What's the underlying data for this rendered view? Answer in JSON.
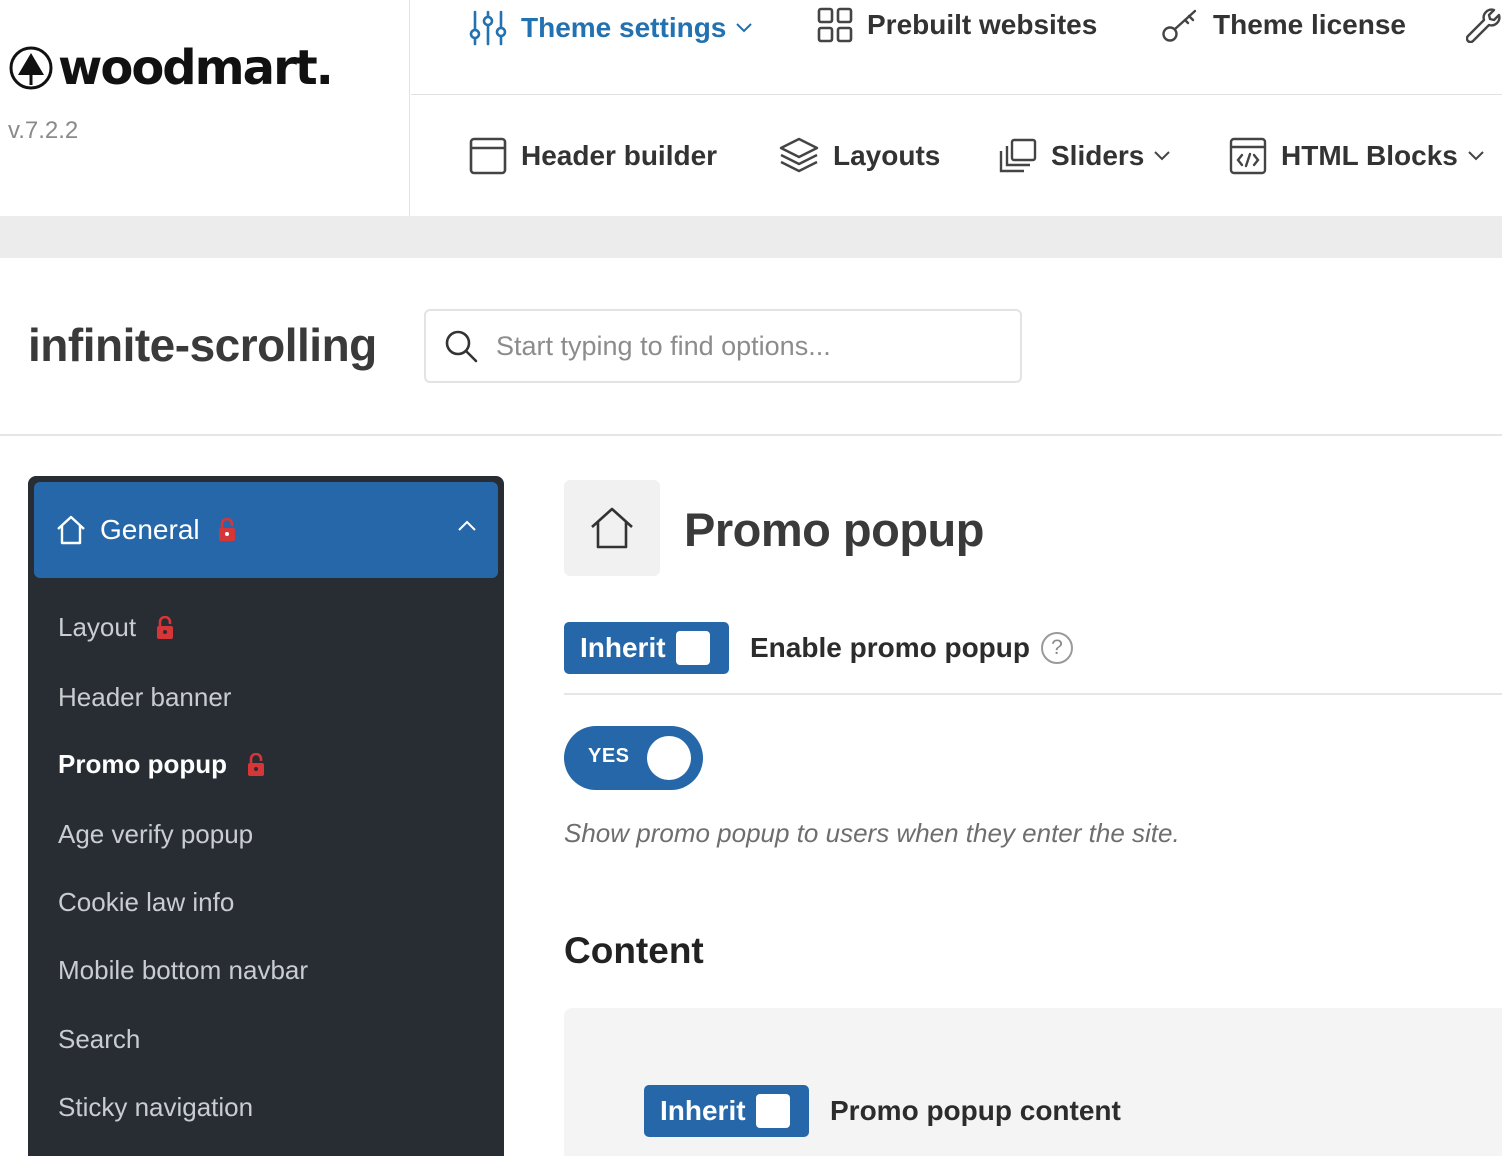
{
  "brand": {
    "logo_text": "woodmart.",
    "version": "v.7.2.2"
  },
  "nav": {
    "row1": [
      {
        "label": "Theme settings",
        "icon": "sliders-icon",
        "active": true,
        "dropdown": true
      },
      {
        "label": "Prebuilt websites",
        "icon": "grid-icon"
      },
      {
        "label": "Theme license",
        "icon": "key-icon"
      },
      {
        "label": "",
        "icon": "wrench-icon"
      }
    ],
    "row2": [
      {
        "label": "Header builder",
        "icon": "window-icon"
      },
      {
        "label": "Layouts",
        "icon": "layers-icon"
      },
      {
        "label": "Sliders",
        "icon": "slides-icon",
        "dropdown": true
      },
      {
        "label": "HTML Blocks",
        "icon": "code-icon",
        "dropdown": true
      }
    ]
  },
  "page": {
    "title": "infinite-scrolling",
    "search_placeholder": "Start typing to find options..."
  },
  "sidebar": {
    "section": {
      "label": "General",
      "icon": "home-icon",
      "locked": true,
      "expanded": true
    },
    "items": [
      {
        "label": "Layout",
        "locked": true
      },
      {
        "label": "Header banner",
        "locked": false
      },
      {
        "label": "Promo popup",
        "locked": true,
        "current": true
      },
      {
        "label": "Age verify popup",
        "locked": false
      },
      {
        "label": "Cookie law info",
        "locked": false
      },
      {
        "label": "Mobile bottom navbar",
        "locked": false
      },
      {
        "label": "Search",
        "locked": false
      },
      {
        "label": "Sticky navigation",
        "locked": false
      }
    ]
  },
  "main": {
    "section_title": "Promo popup",
    "section_icon": "home-icon",
    "enable_option": {
      "inherit_label": "Inherit",
      "label": "Enable promo popup",
      "help": "?",
      "toggle_label": "YES",
      "toggle_on": true,
      "description": "Show promo popup to users when they enter the site."
    },
    "content_heading": "Content",
    "content_option": {
      "inherit_label": "Inherit",
      "label": "Promo popup content"
    }
  },
  "colors": {
    "accent": "#2567a8",
    "link_active": "#2271b1",
    "sidebar_bg": "#282d33",
    "lock": "#d63638",
    "text": "#3a3a3a"
  }
}
